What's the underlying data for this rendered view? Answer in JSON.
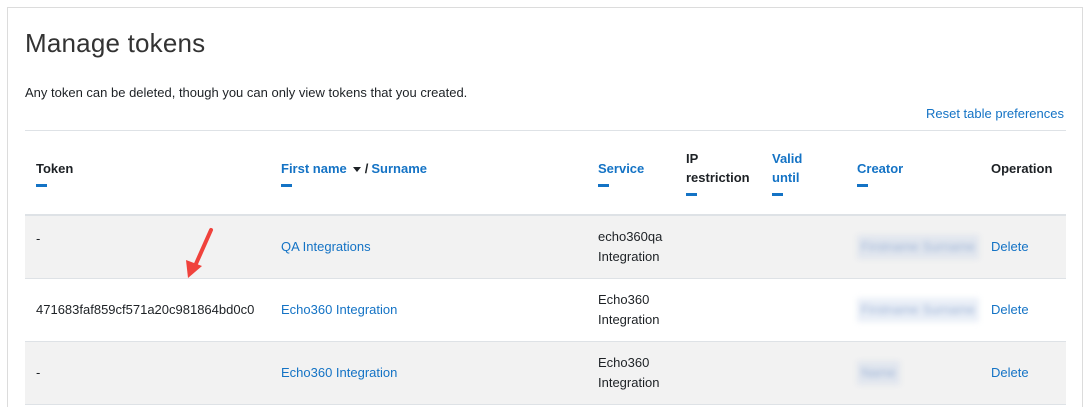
{
  "page": {
    "title": "Manage tokens",
    "description": "Any token can be deleted, though you can only view tokens that you created.",
    "reset_link": "Reset table preferences"
  },
  "table": {
    "headers": {
      "token": "Token",
      "first_name": "First name",
      "separator": "/",
      "surname": "Surname",
      "service": "Service",
      "ip_restriction": "IP restriction",
      "valid_until": "Valid until",
      "creator": "Creator",
      "operation": "Operation"
    },
    "sort_indicator": "caret-down-icon",
    "rows": [
      {
        "token": "-",
        "name": "QA Integrations",
        "service": "echo360qa Integration",
        "ip_restriction": "",
        "valid_until": "",
        "creator": "Firstname Surname",
        "operation": "Delete"
      },
      {
        "token": "471683faf859cf571a20c981864bd0c0",
        "name": "Echo360 Integration",
        "service": "Echo360 Integration",
        "ip_restriction": "",
        "valid_until": "",
        "creator": "Firstname Surname",
        "operation": "Delete"
      },
      {
        "token": "-",
        "name": "Echo360 Integration",
        "service": "Echo360 Integration",
        "ip_restriction": "",
        "valid_until": "",
        "creator": "Name",
        "operation": "Delete"
      }
    ]
  },
  "annotation": {
    "icon": "red-arrow-icon",
    "color": "#f0423c"
  },
  "colors": {
    "link": "#1473c5",
    "row_alt": "#f2f2f2",
    "border": "#dee2e6"
  }
}
